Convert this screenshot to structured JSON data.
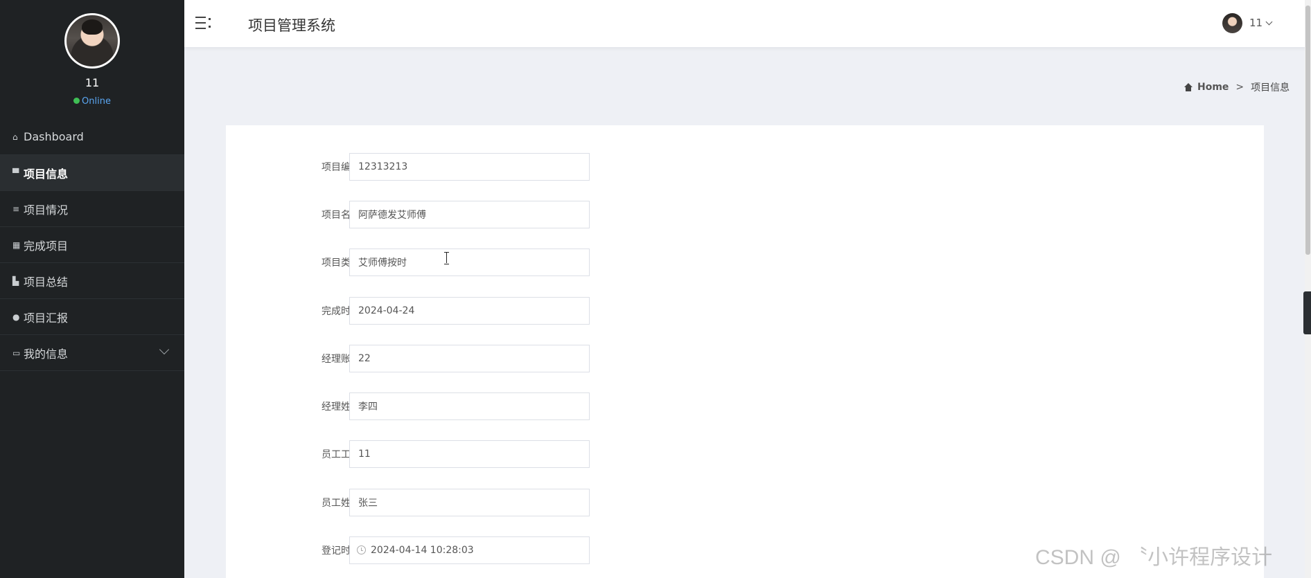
{
  "sidebar": {
    "user_name": "11",
    "status": "Online",
    "items": [
      {
        "icon": "home-icon",
        "glyph": "⌂",
        "label": "Dashboard"
      },
      {
        "icon": "monitor-icon",
        "glyph": "▀",
        "label": "项目信息"
      },
      {
        "icon": "list-icon",
        "glyph": "≡",
        "label": "项目情况"
      },
      {
        "icon": "grid-icon",
        "glyph": "▦",
        "label": "完成项目"
      },
      {
        "icon": "chart-icon",
        "glyph": "▙",
        "label": "项目总结"
      },
      {
        "icon": "user-icon",
        "glyph": "●",
        "label": "项目汇报"
      },
      {
        "icon": "card-icon",
        "glyph": "▭",
        "label": "我的信息"
      }
    ]
  },
  "header": {
    "title": "项目管理系统",
    "user": "11"
  },
  "breadcrumb": {
    "home": "Home",
    "separator": ">",
    "current": "项目信息"
  },
  "form": {
    "fields": [
      {
        "label": "项目编号",
        "value": "12313213"
      },
      {
        "label": "项目名称",
        "value": "阿萨德发艾师傅"
      },
      {
        "label": "项目类型",
        "value": "艾师傅按时"
      },
      {
        "label": "完成时间",
        "value": "2024-04-24"
      },
      {
        "label": "经理账号",
        "value": "22"
      },
      {
        "label": "经理姓名",
        "value": "李四"
      },
      {
        "label": "员工工号",
        "value": "11"
      },
      {
        "label": "员工姓名",
        "value": "张三"
      },
      {
        "label": "登记时间",
        "value": "2024-04-14 10:28:03"
      }
    ]
  },
  "watermark": "CSDN @ 〝小许程序设计"
}
